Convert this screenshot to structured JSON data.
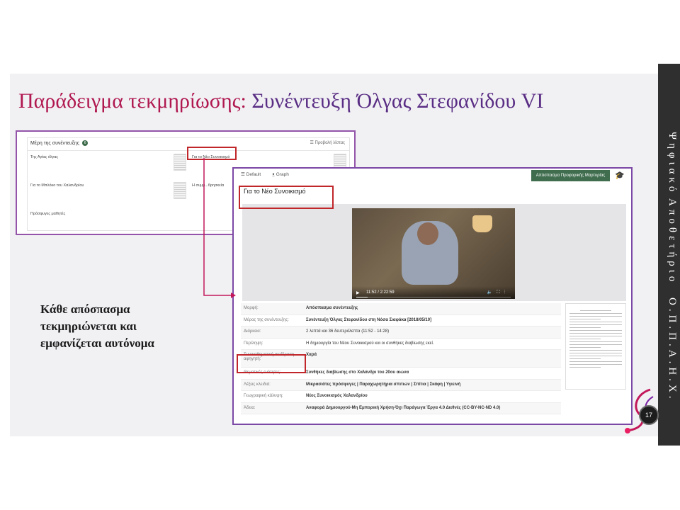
{
  "slide": {
    "title_part1": "Παράδειγμα τεκμηρίωσης:",
    "title_part2": "Συνέντευξη Όλγας Στεφανίδου VI",
    "caption_lines": [
      "Κάθε απόσπασμα",
      "τεκμηριώνεται και",
      "εμφανίζεται αυτόνομα"
    ],
    "page_number": "17",
    "sidebar_text": [
      "Ψηφιακό",
      "Αποθετήριο",
      "Ο.Π.Π.Α.Η.Χ."
    ]
  },
  "panel1": {
    "header": "Μέρη της συνέντευξης",
    "count": "6",
    "list_view": "☰ Προβολή λίστας",
    "cells": [
      "Της Αγίας όλγας",
      "Για το Νέο Συνοικισμό",
      "Για το Μπλόκο του Χαλανδρίου",
      "Η συμμ...θρησκεία",
      "Πρόσφυγες μαθητές"
    ]
  },
  "panel2": {
    "tabs": [
      "☰ Default",
      "ꔸ Graph"
    ],
    "extract_button": "Απόσπασμα Προφορικής Μαρτυρίας",
    "fragment_title": "Για το Νέο Συνοικισμό",
    "video_time": "11:52 / 2:22:59",
    "meta": [
      {
        "label": "Μορφή:",
        "value": "Απόσπασμα συνέντευξης",
        "bold": true
      },
      {
        "label": "Μέρος της συνέντευξης:",
        "value": "Συνέντευξη Όλγας Στεφανίδου στη Νόσα Σιαφάκα [2018/05/10]",
        "bold": true
      },
      {
        "label": "Διάρκεια:",
        "value": "2 λεπτά και 36 δευτερόλεπτα (11:52 - 14:28)",
        "bold": false
      },
      {
        "label": "Περίληψη:",
        "value": "Η δημιουργία του Νέου Συνοικισμού και οι συνθήκες διαβίωσης εκεί.",
        "bold": false
      },
      {
        "label": "Συναισθηματική αντίδραση αφηγητή:",
        "value": "Χαρά",
        "bold": true
      },
      {
        "label": "Θεματικές ενότητες:",
        "value": "Συνθήκες διαβίωσης στο Χαλάνδρι του 20ου αιώνα",
        "bold": true
      },
      {
        "label": "Λέξεις κλειδιά:",
        "value": "Μικρασιάτες πρόσφυγες | Παραχωρητήρια σπιτιών | Σπίτια | Σκάφη | Υγιεινή",
        "bold": true
      },
      {
        "label": "Γεωγραφική κάλυψη:",
        "value": "Νέος Συνοικισμός Χαλανδρίου",
        "bold": true
      },
      {
        "label": "Άδεια:",
        "value": "Αναφορά Δημιουργού-Μη Εμπορική Χρήση-Όχι Παράγωγα Έργα 4.0 Διεθνές (CC-BY-NC-ND 4.0)",
        "bold": true
      }
    ]
  }
}
